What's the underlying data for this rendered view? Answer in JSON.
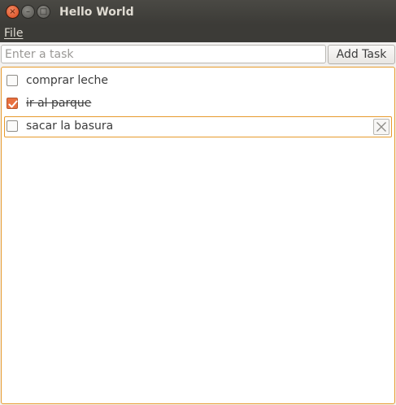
{
  "window": {
    "title": "Hello World",
    "close_icon": "×",
    "minimize_icon": "–",
    "maximize_icon": "□"
  },
  "menubar": {
    "items": [
      {
        "label": "File"
      }
    ]
  },
  "input": {
    "placeholder": "Enter a task",
    "value": ""
  },
  "add_button": {
    "label": "Add Task"
  },
  "tasks": [
    {
      "label": "comprar leche",
      "done": false
    },
    {
      "label": "ir al parque",
      "done": true
    },
    {
      "label": "sacar la basura",
      "done": false,
      "selected": true
    }
  ],
  "colors": {
    "accent": "#e9703f",
    "focus_border": "#e79a2c",
    "titlebar": "#3c3b37"
  }
}
